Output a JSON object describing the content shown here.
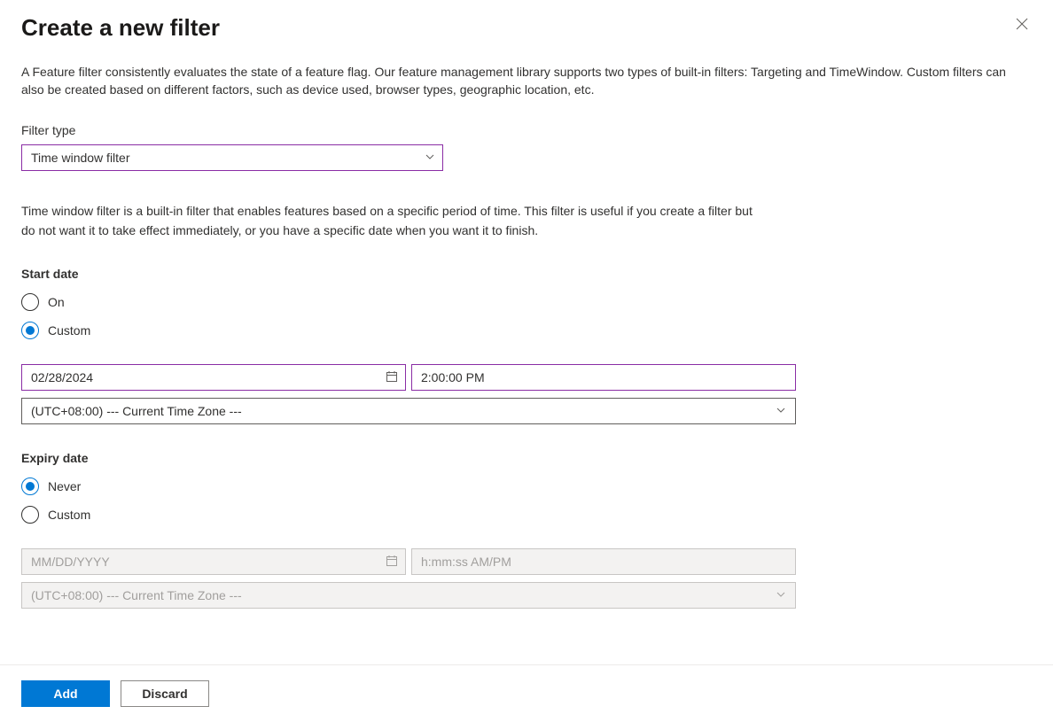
{
  "header": {
    "title": "Create a new filter"
  },
  "intro": "A Feature filter consistently evaluates the state of a feature flag. Our feature management library supports two types of built-in filters: Targeting and TimeWindow. Custom filters can also be created based on different factors, such as device used, browser types, geographic location, etc.",
  "filter_type": {
    "label": "Filter type",
    "value": "Time window filter",
    "description": "Time window filter is a built-in filter that enables features based on a specific period of time. This filter is useful if you create a filter but do not want it to take effect immediately, or you have a specific date when you want it to finish."
  },
  "start_date": {
    "label": "Start date",
    "options": {
      "on": "On",
      "custom": "Custom"
    },
    "selected": "custom",
    "date_value": "02/28/2024",
    "time_value": "2:00:00 PM",
    "timezone_value": "(UTC+08:00) --- Current Time Zone ---"
  },
  "expiry_date": {
    "label": "Expiry date",
    "options": {
      "never": "Never",
      "custom": "Custom"
    },
    "selected": "never",
    "date_placeholder": "MM/DD/YYYY",
    "time_placeholder": "h:mm:ss AM/PM",
    "timezone_value": "(UTC+08:00) --- Current Time Zone ---"
  },
  "footer": {
    "add_label": "Add",
    "discard_label": "Discard"
  }
}
